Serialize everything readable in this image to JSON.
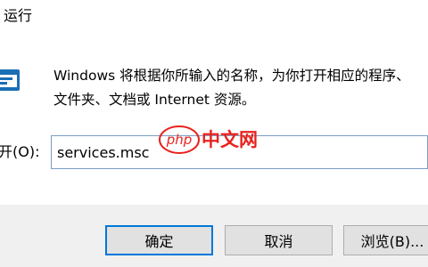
{
  "window": {
    "title": "运行"
  },
  "dialog": {
    "icon": "run-icon",
    "description_line1": "Windows 将根据你所输入的名称，为你打开相应的程序、",
    "description_line2": "文件夹、文档或 Internet 资源。",
    "open_label": "开(O):",
    "open_value": "services.msc"
  },
  "watermark": {
    "brand": "php",
    "text": "中文网"
  },
  "buttons": {
    "ok": "确定",
    "cancel": "取消",
    "browse": "浏览(B)..."
  },
  "colors": {
    "focus_border": "#0078d7",
    "footer_bg": "#f0f0f0",
    "watermark_red": "#e8221d"
  }
}
